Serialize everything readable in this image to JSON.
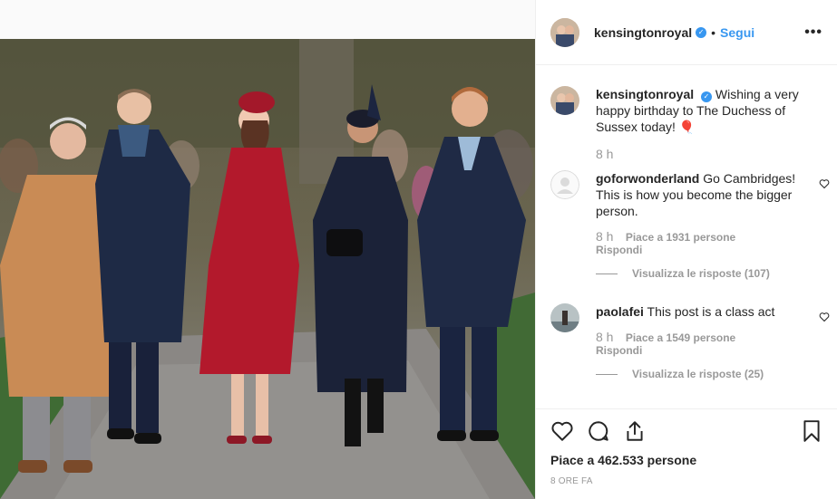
{
  "post": {
    "username": "kensingtonroyal",
    "follow_label": "Segui",
    "separator": "•",
    "more_label": "•••",
    "caption": {
      "username": "kensingtonroyal",
      "text": "Wishing a very happy birthday to The Duchess of Sussex today! 🎈",
      "time": "8 h"
    },
    "comments": [
      {
        "username": "goforwonderland",
        "text": "Go Cambridges! This is how you become the bigger person.",
        "time": "8 h",
        "likes": "Piace a 1931 persone",
        "reply": "Rispondi",
        "view_replies": "Visualizza le risposte (107)"
      },
      {
        "username": "paolafei",
        "text": "This post is a class act",
        "time": "8 h",
        "likes": "Piace a 1549 persone",
        "reply": "Rispondi",
        "view_replies": "Visualizza le risposte (25)"
      }
    ],
    "likes_total": "Piace a 462.533 persone",
    "posted_ago": "8 ORE FA"
  },
  "icons": {
    "like": "heart-icon",
    "comment": "comment-icon",
    "share": "share-icon",
    "save": "bookmark-icon",
    "verified": "verified-badge-icon"
  },
  "colors": {
    "link_blue": "#3897f0",
    "text": "#262626",
    "muted": "#999999",
    "border": "#efefef"
  }
}
